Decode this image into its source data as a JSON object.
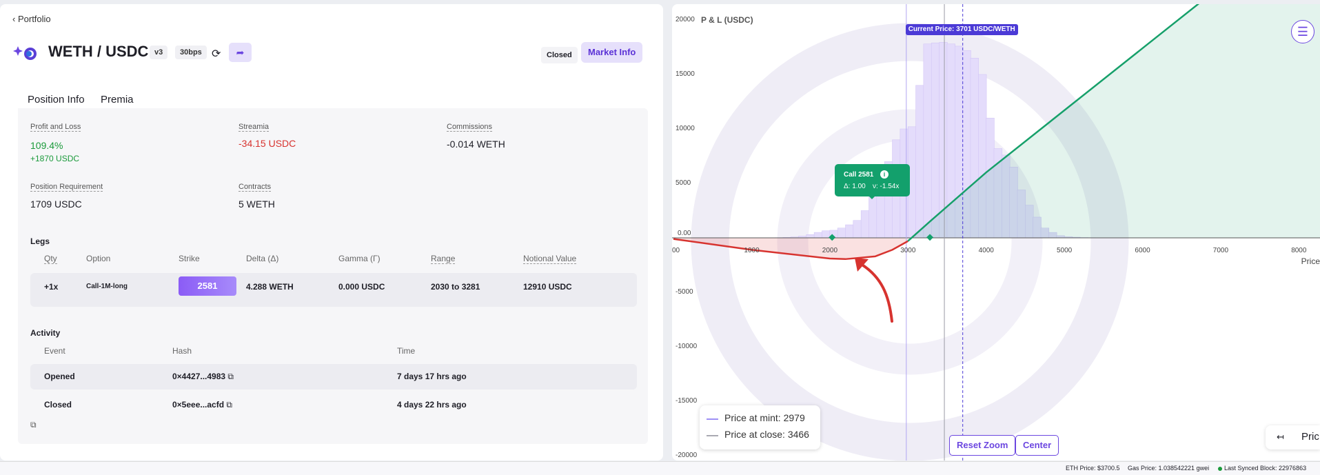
{
  "nav": {
    "back_label": "Portfolio"
  },
  "header": {
    "pair": "WETH / USDC",
    "version": "v3",
    "fee": "30bps",
    "status": "Closed",
    "market_info_label": "Market Info"
  },
  "tabs": [
    {
      "label": "Position Info"
    },
    {
      "label": "Premia"
    }
  ],
  "summary": {
    "pnl_label": "Profit and Loss",
    "pnl_pct": "109.4%",
    "pnl_usdc": "+1870 USDC",
    "streamia_label": "Streamia",
    "streamia_value": "-34.15 USDC",
    "commissions_label": "Commissions",
    "commissions_value": "-0.014 WETH",
    "requirement_label": "Position Requirement",
    "requirement_value": "1709 USDC",
    "contracts_label": "Contracts",
    "contracts_value": "5 WETH"
  },
  "legs": {
    "title": "Legs",
    "headers": [
      "Qty",
      "Option",
      "Strike",
      "Delta (Δ)",
      "Gamma (Γ)",
      "Range",
      "Notional Value"
    ],
    "rows": [
      {
        "qty": "+1x",
        "option": "Call-1M-long",
        "strike": "2581",
        "delta": "4.288 WETH",
        "gamma": "0.000 USDC",
        "range": "2030 to 3281",
        "notional": "12910 USDC"
      }
    ]
  },
  "activity": {
    "title": "Activity",
    "headers": [
      "Event",
      "Hash",
      "Time"
    ],
    "rows": [
      {
        "event": "Opened",
        "hash": "0×4427...4983",
        "time": "7 days 17 hrs ago"
      },
      {
        "event": "Closed",
        "hash": "0×5eee...acfd",
        "time": "4 days 22 hrs ago"
      }
    ]
  },
  "chart_data": {
    "type": "line",
    "title": "",
    "ylabel": "P & L (USDC)",
    "xlabel": "Price",
    "xlim": [
      0,
      8300
    ],
    "ylim": [
      -20000,
      20000
    ],
    "x_ticks": [
      "00",
      "1000",
      "2000",
      "3000",
      "4000",
      "5000",
      "6000",
      "7000",
      "8000"
    ],
    "y_ticks": [
      "20000",
      "15000",
      "10000",
      "5000",
      "0.00",
      "-5000",
      "-10000",
      "-15000",
      "-20000"
    ],
    "current_price_label": "Current Price: 3701 USDC/WETH",
    "current_price": 3701,
    "price_at_mint": 2979,
    "price_at_close": 3466,
    "legend": [
      "Price at mint: 2979",
      "Price at close: 3466"
    ],
    "tooltip": {
      "title": "Call 2581",
      "delta": "Δ: 1.00",
      "vega": "ν: -1.54x"
    },
    "series": [
      {
        "name": "P & L",
        "color": "#16a06a",
        "x": [
          0,
          1000,
          2000,
          2200,
          2581,
          2800,
          3000,
          3281,
          4000,
          5000,
          6000,
          7000,
          8000,
          8300
        ],
        "y": [
          -100,
          -1100,
          -1900,
          -1950,
          -1700,
          -1100,
          -300,
          1500,
          6000,
          11700,
          17400,
          23100,
          28800,
          30500
        ]
      }
    ],
    "histogram": {
      "bin_width": 100,
      "start": 1300,
      "values": [
        20,
        40,
        80,
        160,
        300,
        500,
        650,
        700,
        900,
        1200,
        1600,
        2500,
        4000,
        5500,
        7000,
        9000,
        10000,
        10200,
        14000,
        17800,
        17900,
        17950,
        17800,
        17600,
        17200,
        16500,
        15000,
        11000,
        8200,
        7600,
        6500,
        4400,
        3000,
        1900,
        900,
        500,
        200,
        100,
        60,
        30,
        20,
        10,
        8,
        6,
        5
      ]
    }
  },
  "controls": {
    "reset_zoom": "Reset Zoom",
    "center": "Center",
    "price_toggle": "Pric"
  },
  "footer": {
    "eth_price": "ETH Price: $3700.5",
    "gas_price": "Gas Price: 1.038542221 gwei",
    "synced_block": "Last Synced Block: 22976863"
  },
  "colors": {
    "accent": "#6b46e0",
    "profit": "#16a06a",
    "loss": "#d7332f"
  }
}
